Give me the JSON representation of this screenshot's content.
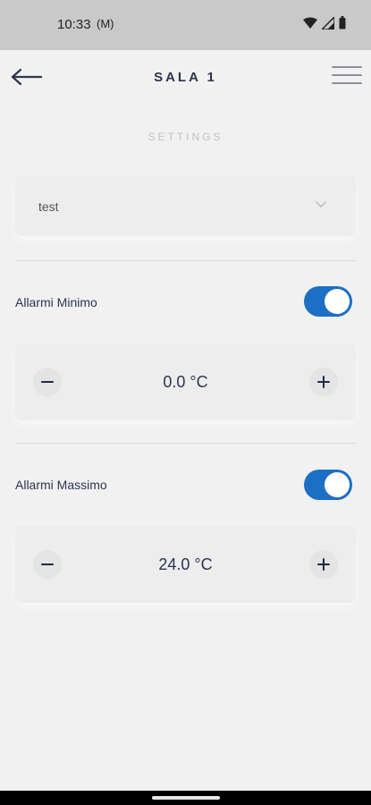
{
  "status_bar": {
    "time": "10:33",
    "cast_icon_label": "(M)"
  },
  "app_bar": {
    "title": "SALA 1"
  },
  "settings": {
    "section_title": "SETTINGS",
    "selected_option": "test"
  },
  "alarm_min": {
    "label": "Allarmi Minimo",
    "enabled": true,
    "value": "0.0 °C"
  },
  "alarm_max": {
    "label": "Allarmi Massimo",
    "enabled": true,
    "value": "24.0 °C"
  },
  "colors": {
    "accent": "#1c6fc4",
    "title_text": "#2b3550",
    "background": "#f1f1f1",
    "status_bar": "#c9c9c9"
  }
}
